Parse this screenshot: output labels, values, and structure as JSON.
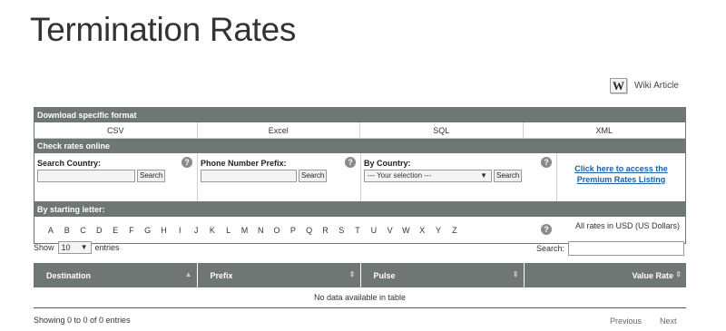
{
  "title": "Termination Rates",
  "wiki": {
    "icon": "wikipedia-icon",
    "glyph": "W",
    "label": "Wiki Article"
  },
  "download": {
    "header": "Download specific format",
    "formats": [
      "CSV",
      "Excel",
      "SQL",
      "XML"
    ]
  },
  "check": {
    "header": "Check rates online",
    "search_country": {
      "label": "Search Country:",
      "value": "",
      "button": "Search"
    },
    "prefix": {
      "label": "Phone Number Prefix:",
      "value": "",
      "button": "Search"
    },
    "by_country": {
      "label": "By Country:",
      "selected": "--- Your selection ---",
      "button": "Search"
    },
    "premium_link": "Click here to access the Premium Rates Listing",
    "help_glyph": "?"
  },
  "letters": {
    "header": "By starting letter:",
    "items": [
      "A",
      "B",
      "C",
      "D",
      "E",
      "F",
      "G",
      "H",
      "I",
      "J",
      "K",
      "L",
      "M",
      "N",
      "O",
      "P",
      "Q",
      "R",
      "S",
      "T",
      "U",
      "V",
      "W",
      "X",
      "Y",
      "Z"
    ],
    "currency_note": "All rates in USD (US Dollars)"
  },
  "table_controls": {
    "show_label": "Show",
    "entries_value": "10",
    "entries_label": "entries",
    "search_label": "Search:",
    "search_value": ""
  },
  "table": {
    "columns": [
      "Destination",
      "Prefix",
      "Pulse",
      "Value Rate"
    ],
    "empty_message": "No data available in table"
  },
  "footer": {
    "info": "Showing 0 to 0 of 0 entries",
    "previous": "Previous",
    "next": "Next"
  }
}
